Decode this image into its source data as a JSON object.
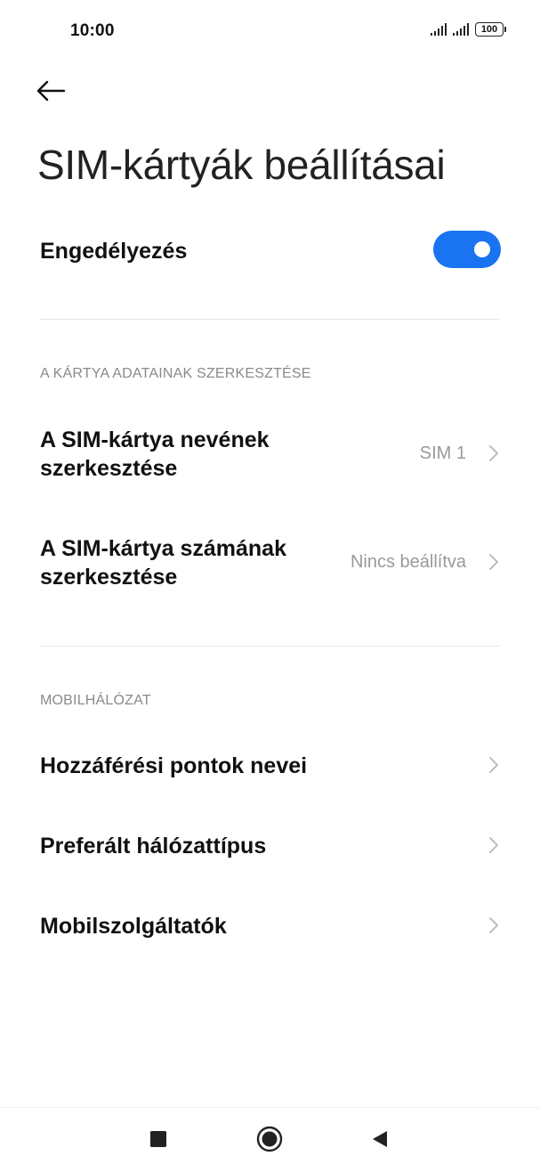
{
  "status_bar": {
    "time": "10:00",
    "battery": "100"
  },
  "header": {
    "back_icon": "back-arrow-icon",
    "title": "SIM-kártyák beállításai"
  },
  "enable": {
    "label": "Engedélyezés",
    "toggle_on": true,
    "toggle_color": "#1a73f0"
  },
  "sections": {
    "card_data": {
      "header": "A KÁRTYA ADATAINAK SZERKESZTÉSE",
      "items": [
        {
          "label_line1": "A SIM-kártya nevének",
          "label_line2": "szerkesztése",
          "value": "SIM 1"
        },
        {
          "label_line1": "A SIM-kártya számának",
          "label_line2": "szerkesztése",
          "value": "Nincs beállítva"
        }
      ]
    },
    "mobile_network": {
      "header": "MOBILHÁLÓZAT",
      "items": [
        {
          "label": "Hozzáférési pontok nevei"
        },
        {
          "label": "Preferált hálózattípus"
        },
        {
          "label": "Mobilszolgáltatók"
        }
      ]
    }
  },
  "nav_bar": {
    "recents_icon": "square-icon",
    "home_icon": "circle-icon",
    "back_icon": "triangle-back-icon"
  }
}
